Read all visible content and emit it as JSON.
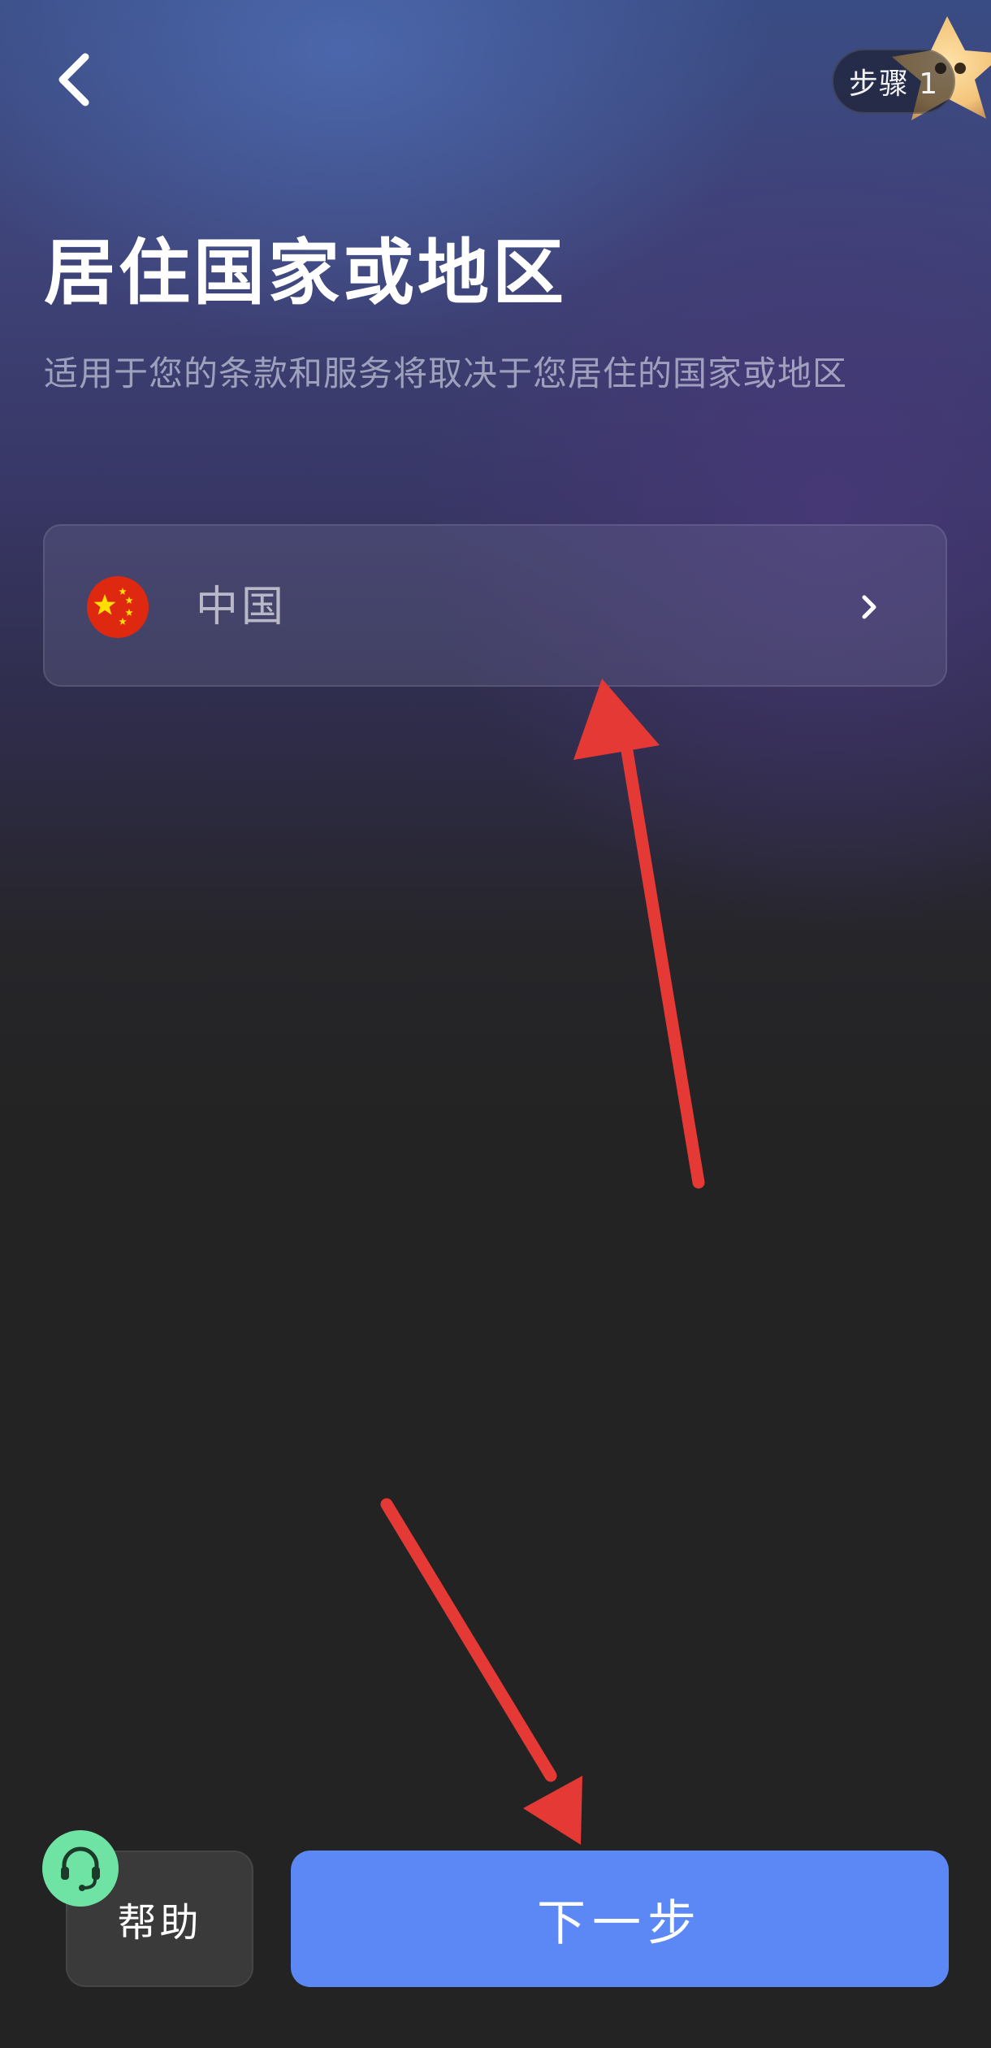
{
  "header": {
    "back_icon": "chevron-left-icon",
    "step_label": "步骤 1"
  },
  "page": {
    "title": "居住国家或地区",
    "subtitle": "适用于您的条款和服务将取决于您居住的国家或地区"
  },
  "country_selector": {
    "flag_icon": "china-flag-icon",
    "value": "中国",
    "chevron_icon": "chevron-right-icon"
  },
  "footer": {
    "help_label": "帮助",
    "support_icon": "headset-icon",
    "next_label": "下一步"
  },
  "colors": {
    "primary_button": "#5b88f5",
    "support_icon_bg": "#6ee3a4",
    "annotation_arrow": "#e53935",
    "flag_red": "#de2910",
    "flag_yellow": "#ffde00"
  }
}
